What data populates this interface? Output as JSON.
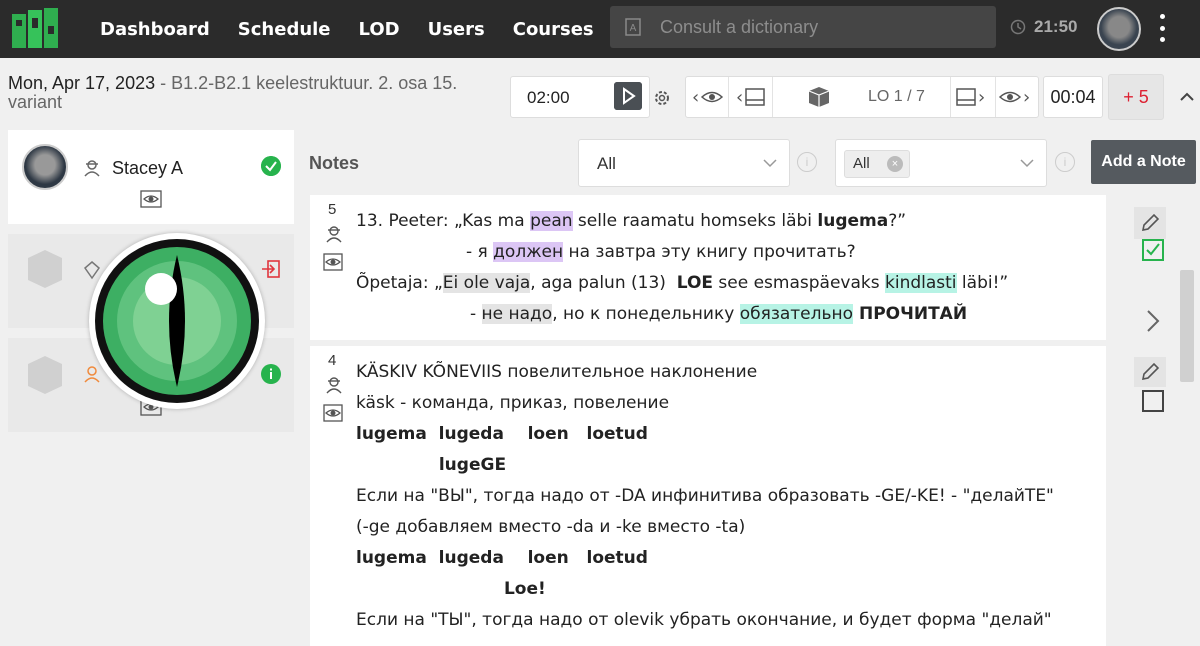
{
  "nav": {
    "items": [
      "Dashboard",
      "Schedule",
      "LOD",
      "Users",
      "Courses"
    ],
    "dictionary_placeholder": "Consult a dictionary",
    "time": "21:50"
  },
  "header": {
    "date": "Mon, Apr 17, 2023",
    "lesson": "- B1.2-B2.1 keelestruktuur. 2. osa 15. variant",
    "timer": "02:00",
    "lo_label": "LO 1 / 7",
    "elapsed": "00:04",
    "plus_label": "+ 5"
  },
  "students": [
    {
      "name": "Stacey A",
      "status": "check"
    }
  ],
  "notes": {
    "title": "Notes",
    "filter1": "All",
    "filter2_chip": "All",
    "add_label": "Add a Note"
  },
  "note1": {
    "num": "5",
    "l1a": "13. Peeter: „Kas ma ",
    "l1b": "pean",
    "l1c": " selle raamatu homseks läbi ",
    "l1d": "lugema",
    "l1e": "?”",
    "l2a": "- я ",
    "l2b": "должен",
    "l2c": " на завтра эту книгу прочитать?",
    "l3a": "Õpetaja: „",
    "l3b": "Ei ole vaja",
    "l3c": ", aga palun (13)  ",
    "l3d": "LOE",
    "l3e": " see esmaspäevaks ",
    "l3f": "kindlasti",
    "l3g": " läbi!”",
    "l4a": "- ",
    "l4b": "не надо",
    "l4c": ", но к понедельнику ",
    "l4d": "обязательно",
    "l4e": " ПРОЧИТАЙ"
  },
  "note2": {
    "num": "4",
    "lines": [
      "KÄSKIV KÕNEVIIS повелительное наклонение",
      "käsk - команда, приказ, повеление",
      "lugema  lugeda    loen   loetud",
      "              lugeGE",
      "Если на \"ВЫ\", тогда надо от -DA инфинитива образовать -GE/-KE! - \"делайТЕ\"",
      "(-ge добавляем вместо -da и -ke вместо -ta)",
      "lugema  lugeda    loen   loetud",
      "                         Loe!",
      "Если на \"ТЫ\", тогда надо от olevik убрать окончание, и будет форма \"делай\""
    ]
  },
  "colors": {
    "accent_green": "#27b34d",
    "topbar": "#2b2b2b",
    "highlight_purple": "#dcc6f5",
    "highlight_teal": "#b7f3e5"
  }
}
